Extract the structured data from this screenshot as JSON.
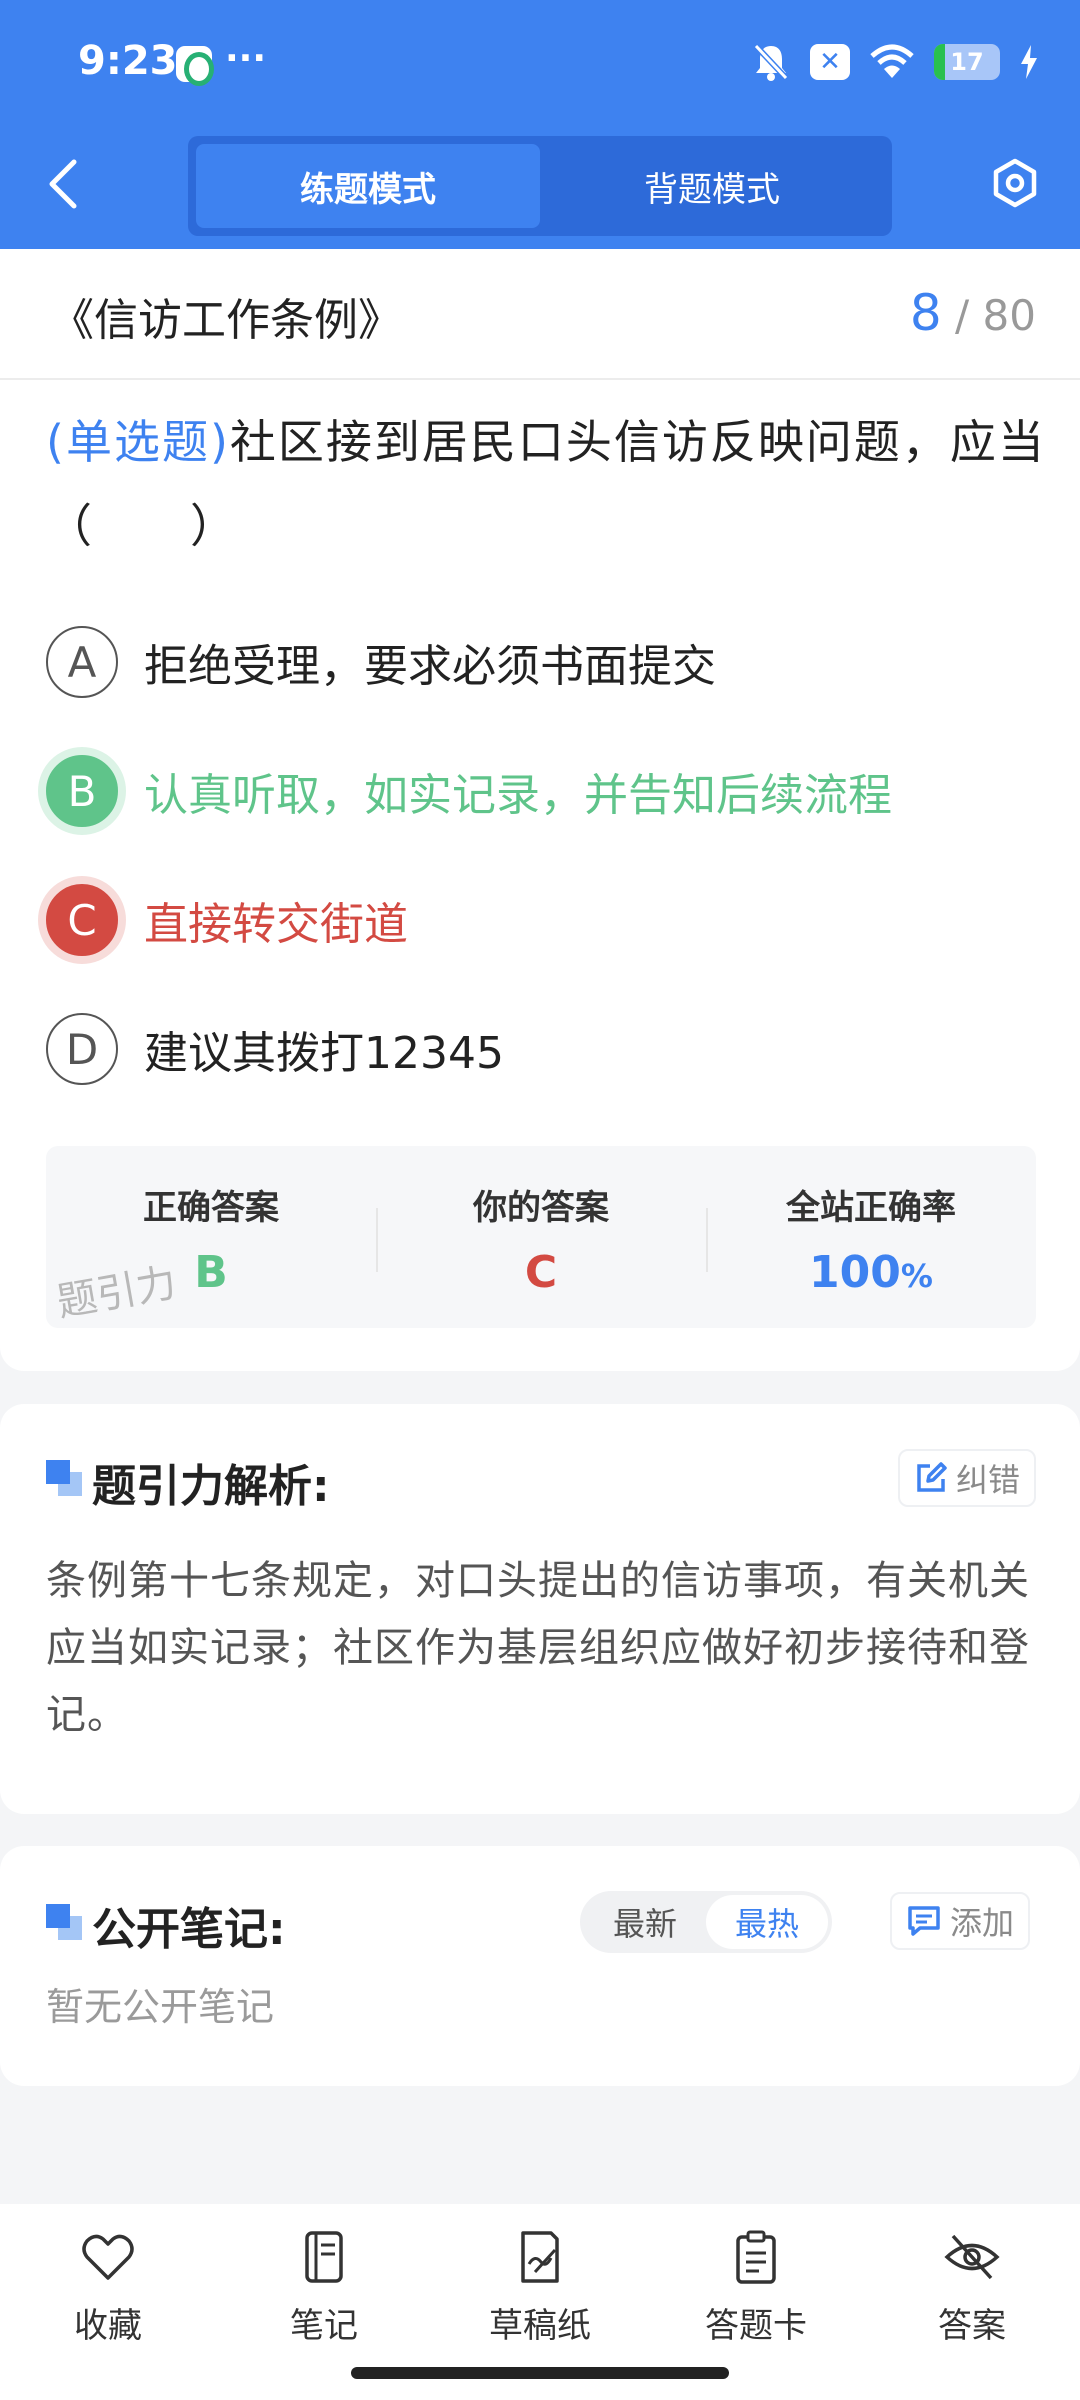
{
  "status_bar": {
    "time": "9:23",
    "dots": "···",
    "close_glyph": "✕",
    "battery": "17",
    "battery_level": 0.17
  },
  "header": {
    "tabs": [
      {
        "label": "练题模式",
        "active": true
      },
      {
        "label": "背题模式",
        "active": false
      }
    ]
  },
  "question": {
    "doc_title": "《信访工作条例》",
    "current": "8",
    "total": "/ 80",
    "type": "(单选题)",
    "text": "社区接到居民口头信访反映问题，应当（　　）",
    "options": [
      {
        "letter": "A",
        "text": "拒绝受理，要求必须书面提交",
        "state": "normal"
      },
      {
        "letter": "B",
        "text": "认真听取，如实记录，并告知后续流程",
        "state": "correct"
      },
      {
        "letter": "C",
        "text": "直接转交街道",
        "state": "wrong"
      },
      {
        "letter": "D",
        "text": "建议其拨打12345",
        "state": "normal"
      }
    ]
  },
  "answer": {
    "correct_label": "正确答案",
    "correct_value": "B",
    "yours_label": "你的答案",
    "yours_value": "C",
    "rate_label": "全站正确率",
    "rate_value": "100",
    "rate_unit": "%",
    "watermark": "题引力"
  },
  "analysis": {
    "title": "题引力解析:",
    "correct_button": "纠错",
    "text": "条例第十七条规定，对口头提出的信访事项，有关机关应当如实记录；社区作为基层组织应做好初步接待和登记。"
  },
  "notes": {
    "title": "公开笔记:",
    "sort_options": [
      {
        "label": "最新",
        "active": false
      },
      {
        "label": "最热",
        "active": true
      }
    ],
    "add_button": "添加",
    "empty_text": "暂无公开笔记"
  },
  "bottom_nav": [
    {
      "label": "收藏",
      "icon": "heart-icon"
    },
    {
      "label": "笔记",
      "icon": "notebook-icon"
    },
    {
      "label": "草稿纸",
      "icon": "draft-icon"
    },
    {
      "label": "答题卡",
      "icon": "clipboard-icon"
    },
    {
      "label": "答案",
      "icon": "eye-off-icon"
    }
  ],
  "colors": {
    "brand": "#3e82f0",
    "correct": "#5fc48a",
    "wrong": "#d34a42"
  }
}
